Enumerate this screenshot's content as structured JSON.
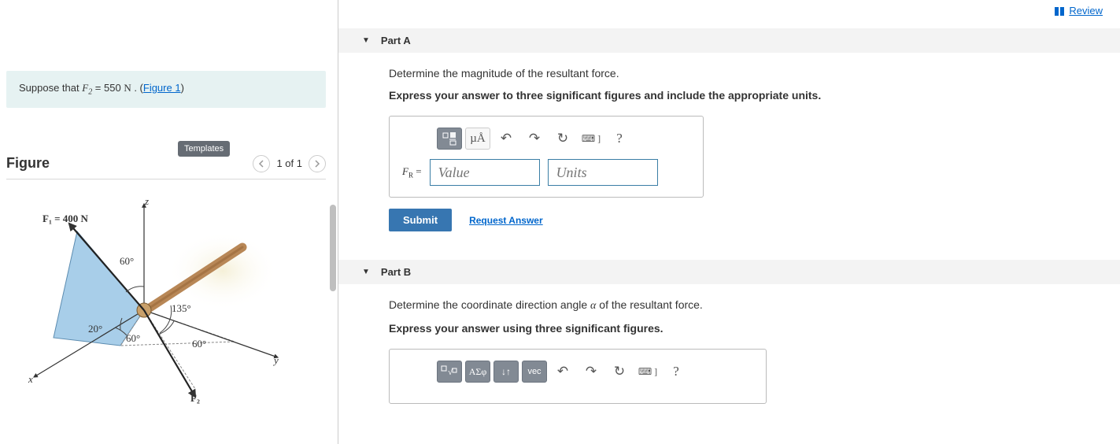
{
  "review_label": "Review",
  "prompt": {
    "prefix": "Suppose that ",
    "force_sym": "F",
    "force_sub": "2",
    "eq": " = 550 ",
    "unit": "N",
    "suffix": " . (",
    "figure_link": "Figure 1",
    "close": ")"
  },
  "figure": {
    "title": "Figure",
    "templates_label": "Templates",
    "pager_text": "1 of 1",
    "labels": {
      "z": "z",
      "y": "y",
      "x": "x",
      "f1": "F₁ = 400 N",
      "f2": "F₂",
      "a60": "60°",
      "a60b": "60°",
      "a60c": "60°",
      "a20": "20°",
      "a135": "135°"
    }
  },
  "partA": {
    "title": "Part A",
    "q1": "Determine the magnitude of the resultant force.",
    "q2": "Express your answer to three significant figures and include the appropriate units.",
    "toolbar": {
      "frac": "□/□",
      "ua": "µÅ",
      "undo": "↶",
      "redo": "↷",
      "reset": "↻",
      "kbd": "⌨ ]",
      "help": "?"
    },
    "fr_label": "F",
    "fr_sub": "R",
    "fr_eq": " = ",
    "value_ph": "Value",
    "units_ph": "Units",
    "submit": "Submit",
    "request": "Request Answer"
  },
  "partB": {
    "title": "Part B",
    "q1_pre": "Determine the coordinate direction angle ",
    "q1_sym": "α",
    "q1_post": " of the resultant force.",
    "q2": "Express your answer using three significant figures.",
    "toolbar": {
      "tmpl": "□√□",
      "greek": "ΑΣφ",
      "arrows": "↓↑",
      "vec": "vec",
      "undo": "↶",
      "redo": "↷",
      "reset": "↻",
      "kbd": "⌨ ]",
      "help": "?"
    }
  }
}
